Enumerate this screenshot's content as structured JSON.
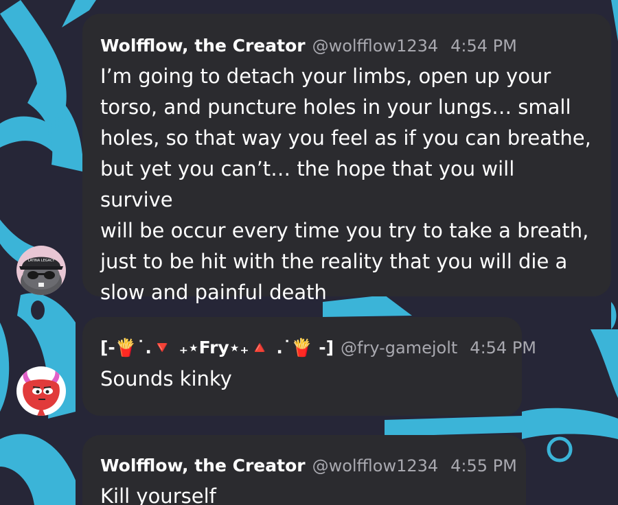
{
  "messages": [
    {
      "author": "Wolfflow, the Creator",
      "handle": "@wolfflow1234",
      "time": "4:54 PM",
      "text": "I’m going to detach your limbs, open up your\ntorso, and puncture holes in your lungs… small\nholes, so that way you feel as if you can breathe,\nbut yet you can’t… the hope that you will survive\nwill be occur every time you try to take a breath,\njust to be hit with the reality that you will die a\nslow and painful death"
    },
    {
      "author": "[-🍟˙.🔻 ₊⋆Fry⋆₊🔺 .˙🍟 -]",
      "handle": "@fry-gamejolt",
      "time": "4:54 PM",
      "text": "Sounds kinky"
    },
    {
      "author": "Wolfflow, the Creator",
      "handle": "@wolfflow1234",
      "time": "4:55 PM",
      "text": "Kill yourself"
    }
  ],
  "avatars": {
    "wolfflow_cap_text": "LATINA LEGACY"
  },
  "colors": {
    "background": "#262637",
    "pattern": "#3bb4d8",
    "bubble": "#2b2b2f",
    "meta_text": "#a9a9b0"
  }
}
